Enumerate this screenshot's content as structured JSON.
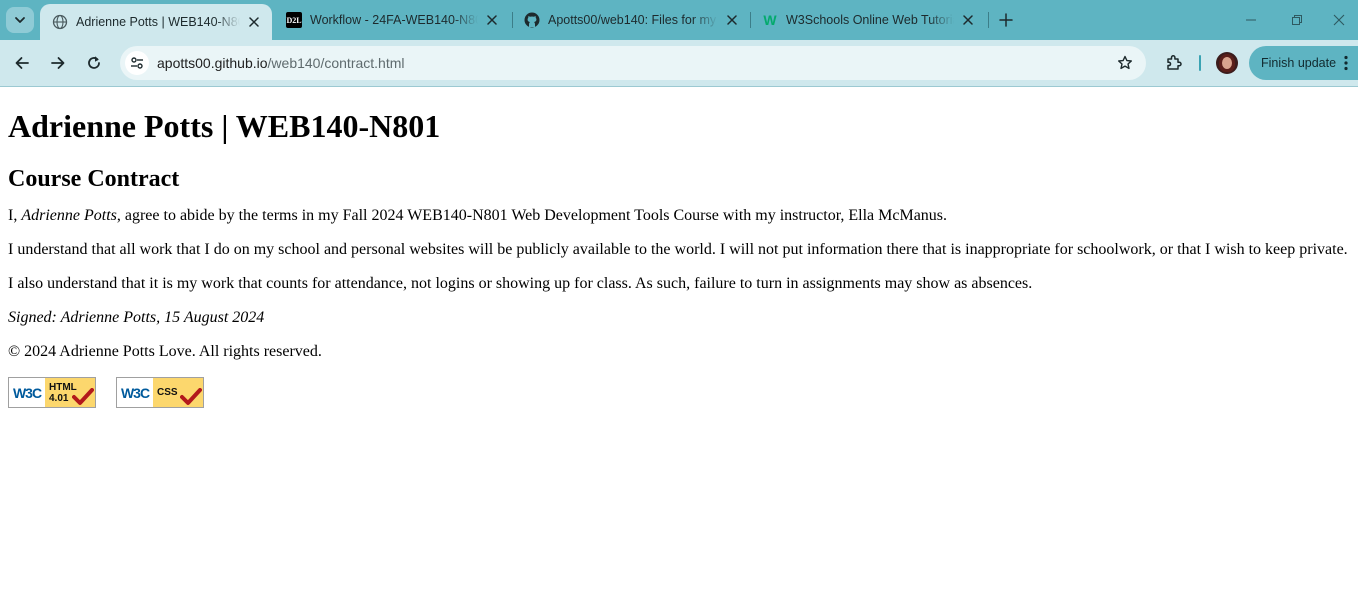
{
  "browser": {
    "tabs": [
      {
        "title": "Adrienne Potts | WEB140-N801",
        "favicon": "globe-icon",
        "active": true
      },
      {
        "title": "Workflow - 24FA-WEB140-N801",
        "favicon": "d2l-icon",
        "favicon_text": "D2L",
        "active": false
      },
      {
        "title": "Apotts00/web140: Files for my",
        "favicon": "github-icon",
        "active": false
      },
      {
        "title": "W3Schools Online Web Tutorials",
        "favicon": "w3schools-icon",
        "favicon_text": "W",
        "active": false
      }
    ],
    "address_bar": {
      "domain": "apotts00.github.io",
      "path": "/web140/contract.html"
    },
    "finish_update_label": "Finish update",
    "colors": {
      "tabstrip": "#5eb4c2",
      "toolbar": "#cfe8ed"
    }
  },
  "page": {
    "heading": "Adrienne Potts | WEB140-N801",
    "subheading": "Course Contract",
    "contract": {
      "intro_prefix": "I, ",
      "intro_name": "Adrienne Potts",
      "intro_suffix": ", agree to abide by the terms in my Fall 2024 WEB140-N801 Web Development Tools Course with my instructor, Ella McManus."
    },
    "paragraph_2": "I understand that all work that I do on my school and personal websites will be publicly available to the world. I will not put information there that is inappropriate for schoolwork, or that I wish to keep private.",
    "paragraph_3": "I also understand that it is my work that counts for attendance, not logins or showing up for class. As such, failure to turn in assignments may show as absences.",
    "signature": "Signed: Adrienne Potts, 15 August 2024",
    "copyright": "© 2024 Adrienne Potts Love. All rights reserved.",
    "badges": [
      {
        "logo": "W3C",
        "line1": "HTML",
        "line2": "4.01"
      },
      {
        "logo": "W3C",
        "line1": "CSS",
        "line2": ""
      }
    ]
  }
}
